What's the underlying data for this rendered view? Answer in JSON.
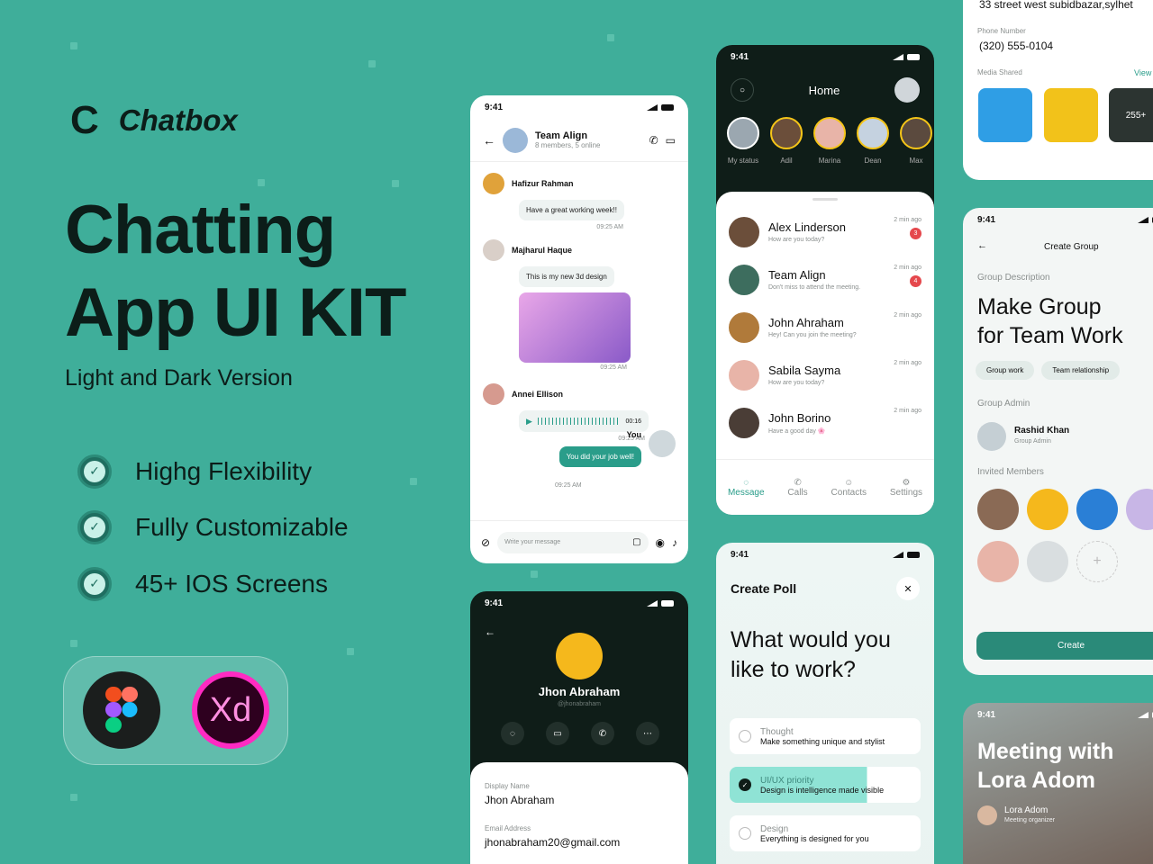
{
  "brand": {
    "logo": "C",
    "name": "Chatbox"
  },
  "hero": {
    "line1": "Chatting",
    "line2": "App UI KIT",
    "subtitle": "Light and Dark Version"
  },
  "features": [
    "Highg Flexibility",
    "Fully Customizable",
    "45+ IOS Screens"
  ],
  "tools": {
    "figma": "figma-logo",
    "xd": "Xd"
  },
  "time": "9:41",
  "group_chat": {
    "title": "Team Align",
    "subtitle": "8 members, 5 online",
    "messages": [
      {
        "sender": "Hafizur Rahman",
        "text": "Have a great working week!!",
        "time": "09:25 AM"
      },
      {
        "sender": "Majharul Haque",
        "text": "This is my new 3d design",
        "time": "09:25 AM"
      },
      {
        "sender": "Annei Ellison",
        "voice_duration": "00:16",
        "time": "09:25 AM"
      },
      {
        "sender": "You",
        "text": "You did your job well!",
        "time": "09:25 AM"
      }
    ],
    "input_placeholder": "Write your message"
  },
  "home": {
    "title": "Home",
    "stories": [
      "My status",
      "Adil",
      "Marina",
      "Dean",
      "Max"
    ],
    "chats": [
      {
        "name": "Alex Linderson",
        "preview": "How are you today?",
        "time": "2 min ago",
        "badge": "3"
      },
      {
        "name": "Team Align",
        "preview": "Don't miss to attend the meeting.",
        "time": "2 min ago",
        "badge": "4"
      },
      {
        "name": "John Ahraham",
        "preview": "Hey! Can you join the meeting?",
        "time": "2 min ago",
        "badge": ""
      },
      {
        "name": "Sabila Sayma",
        "preview": "How are you today?",
        "time": "2 min ago",
        "badge": ""
      },
      {
        "name": "John Borino",
        "preview": "Have a good day 🌸",
        "time": "2 min ago",
        "badge": ""
      }
    ],
    "tabs": [
      "Message",
      "Calls",
      "Contacts",
      "Settings"
    ]
  },
  "contact_info": {
    "address": "33 street west subidbazar,sylhet",
    "phone_label": "Phone Number",
    "phone": "(320) 555-0104",
    "media_label": "Media Shared",
    "view_all": "View",
    "media_more": "255+"
  },
  "create_group": {
    "title": "Create Group",
    "desc_label": "Group Description",
    "heading_1": "Make Group",
    "heading_2": "for Team Work",
    "tags": [
      "Group work",
      "Team relationship"
    ],
    "admin_label": "Group Admin",
    "admin_name": "Rashid Khan",
    "admin_role": "Group Admin",
    "invited_label": "Invited Members",
    "button": "Create"
  },
  "profile": {
    "name": "Jhon Abraham",
    "handle": "@jhonabraham",
    "display_label": "Display Name",
    "display_value": "Jhon Abraham",
    "email_label": "Email Address",
    "email_value": "jhonabraham20@gmail.com"
  },
  "poll": {
    "title": "Create Poll",
    "question_1": "What would you",
    "question_2": "like to  work?",
    "options": [
      {
        "label": "Thought",
        "text": "Make something unique and stylist",
        "selected": false
      },
      {
        "label": "UI/UX priority",
        "text": "Design is intelligence made visible",
        "selected": true
      },
      {
        "label": "Design",
        "text": "Everything is designed for you",
        "selected": false
      }
    ]
  },
  "meeting": {
    "title_1": "Meeting with",
    "title_2": "Lora Adom",
    "name": "Lora Adom",
    "role": "Meeting organizer"
  }
}
